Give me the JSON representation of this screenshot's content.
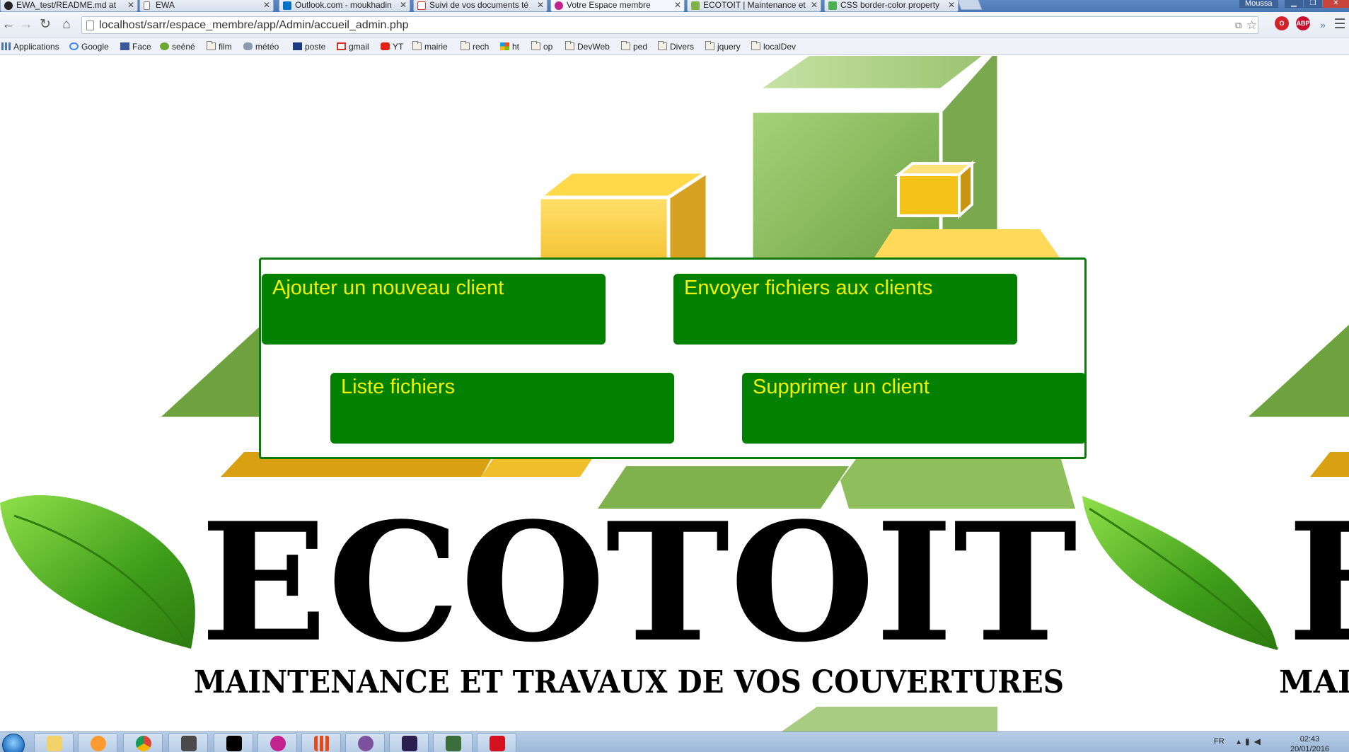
{
  "browser": {
    "tabs": [
      {
        "title": "EWA_test/README.md at",
        "icon": "github-icon",
        "color": "#222222",
        "active": false
      },
      {
        "title": "EWA",
        "icon": "page-icon",
        "color": "#ffffff",
        "active": false
      },
      {
        "title": "Outlook.com - moukhadin",
        "icon": "outlook-icon",
        "color": "#0072c6",
        "active": false
      },
      {
        "title": "Suivi de vos documents té",
        "icon": "gmail-icon",
        "color": "#d93025",
        "active": false
      },
      {
        "title": "Votre Espace membre",
        "icon": "site-icon",
        "color": "#c2248f",
        "active": true
      },
      {
        "title": "ECOTOIT | Maintenance et",
        "icon": "ecotoit-icon",
        "color": "#7cb342",
        "active": false
      },
      {
        "title": "CSS border-color property",
        "icon": "w3schools-icon",
        "color": "#4caf50",
        "active": false
      }
    ],
    "user_name": "Moussa",
    "url": "localhost/sarr/espace_membre/app/Admin/accueil_admin.php",
    "bookmarks": [
      {
        "label": "Applications",
        "icon": "apps-icon"
      },
      {
        "label": "Google",
        "icon": "google-icon"
      },
      {
        "label": "Face",
        "icon": "facebook-icon"
      },
      {
        "label": "seéné",
        "icon": "site-icon"
      },
      {
        "label": "film",
        "icon": "folder-icon"
      },
      {
        "label": "météo",
        "icon": "weather-icon"
      },
      {
        "label": "poste",
        "icon": "post-icon"
      },
      {
        "label": "gmail",
        "icon": "gmail-icon"
      },
      {
        "label": "YT",
        "icon": "youtube-icon"
      },
      {
        "label": "mairie",
        "icon": "folder-icon"
      },
      {
        "label": "rech",
        "icon": "folder-icon"
      },
      {
        "label": "ht",
        "icon": "microsoft-icon"
      },
      {
        "label": "op",
        "icon": "folder-icon"
      },
      {
        "label": "DevWeb",
        "icon": "folder-icon"
      },
      {
        "label": "ped",
        "icon": "folder-icon"
      },
      {
        "label": "Divers",
        "icon": "folder-icon"
      },
      {
        "label": "jquery",
        "icon": "folder-icon"
      },
      {
        "label": "localDev",
        "icon": "folder-icon"
      }
    ]
  },
  "page": {
    "logo_text": "ECOTOIT",
    "tagline": "MAINTENANCE ET TRAVAUX DE VOS COUVERTURES",
    "menu": {
      "add_client": "Ajouter un nouveau client",
      "send_files": "Envoyer fichiers aux clients",
      "list_files": "Liste fichiers",
      "delete_client": "Supprimer un client"
    },
    "colors": {
      "button_bg": "#028100",
      "button_text": "#f2f200",
      "panel_border": "#0a7a0a"
    }
  },
  "taskbar": {
    "apps": [
      "explorer-icon",
      "media-player-icon",
      "chrome-icon",
      "sublime-icon",
      "cmd-icon",
      "wamp-icon",
      "apps-grid-icon",
      "viber-icon",
      "phpstorm-icon",
      "putty-icon",
      "acrobat-icon"
    ],
    "language": "FR",
    "time": "02:43",
    "date": "20/01/2016"
  }
}
